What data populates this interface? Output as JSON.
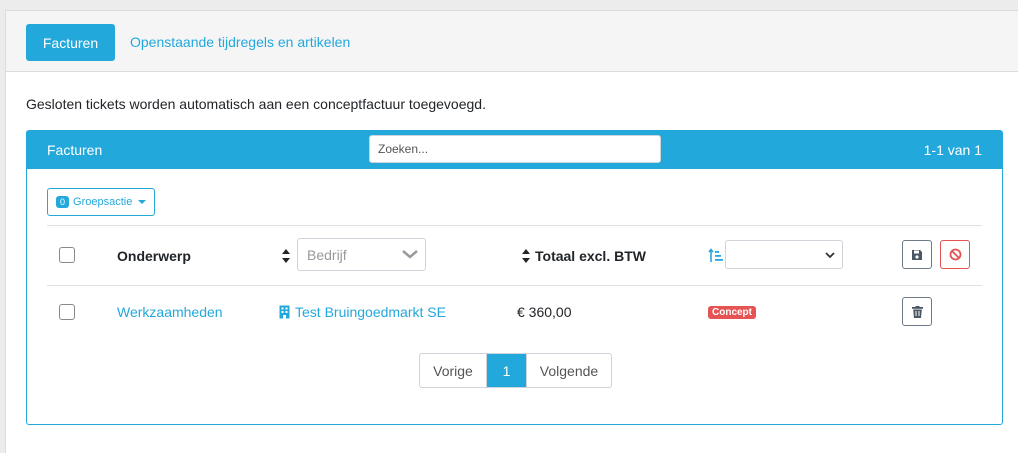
{
  "tabs": {
    "active": "Facturen",
    "other": "Openstaande tijdregels en artikelen"
  },
  "notice": "Gesloten tickets worden automatisch aan een conceptfactuur toegevoegd.",
  "panel": {
    "title": "Facturen",
    "search_placeholder": "Zoeken...",
    "count": "1-1 van 1"
  },
  "group_action": {
    "count": "0",
    "label": "Groepsactie"
  },
  "table": {
    "headers": {
      "subject": "Onderwerp",
      "company_placeholder": "Bedrijf",
      "total": "Totaal excl. BTW"
    },
    "rows": [
      {
        "subject": "Werkzaamheden",
        "company": "Test Bruingoedmarkt SE",
        "total": "€ 360,00",
        "status": "Concept"
      }
    ]
  },
  "pagination": {
    "prev": "Vorige",
    "current": "1",
    "next": "Volgende"
  },
  "colors": {
    "accent": "#23a8dc",
    "danger": "#e55353"
  }
}
